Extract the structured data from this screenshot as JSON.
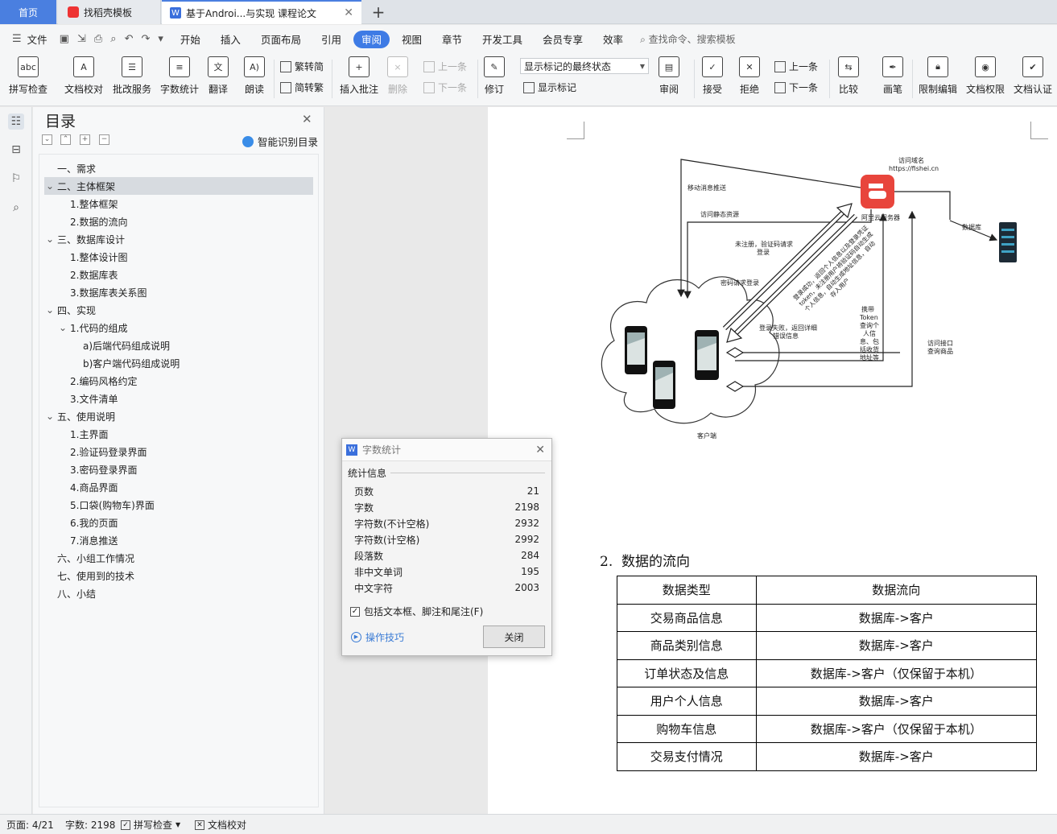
{
  "tabs": {
    "home": "首页",
    "template": "找稻壳模板",
    "document": "基于Androi...与实现 课程论文"
  },
  "menu": {
    "file": "文件",
    "items": [
      "开始",
      "插入",
      "页面布局",
      "引用",
      "审阅",
      "视图",
      "章节",
      "开发工具",
      "会员专享",
      "效率"
    ],
    "active": "审阅",
    "search_placeholder": "查找命令、搜索模板"
  },
  "ribbon": {
    "spellcheck": "拼写检查",
    "doc_proofread": "文档校对",
    "batch_service": "批改服务",
    "word_count": "字数统计",
    "translate": "翻译",
    "read_aloud": "朗读",
    "trad_to_simp": "繁转简",
    "simp_to_trad": "简转繁",
    "insert_comment": "插入批注",
    "delete": "删除",
    "prev_comment": "上一条",
    "next_comment": "下一条",
    "track_changes": "修订",
    "markup_mode": "显示标记的最终状态",
    "show_markup": "显示标记",
    "review": "审阅",
    "accept": "接受",
    "reject": "拒绝",
    "prev_change": "上一条",
    "next_change": "下一条",
    "compare": "比较",
    "pen": "画笔",
    "restrict_edit": "限制编辑",
    "doc_permission": "文档权限",
    "doc_auth": "文档认证"
  },
  "toc": {
    "title": "目录",
    "smart_label": "智能识别目录",
    "items": [
      {
        "label": "一、需求",
        "level": 0,
        "arrow": ""
      },
      {
        "label": "二、主体框架",
        "level": 0,
        "arrow": "v",
        "selected": true
      },
      {
        "label": "1.整体框架",
        "level": 1,
        "arrow": ""
      },
      {
        "label": "2.数据的流向",
        "level": 1,
        "arrow": ""
      },
      {
        "label": "三、数据库设计",
        "level": 0,
        "arrow": "v"
      },
      {
        "label": "1.整体设计图",
        "level": 1,
        "arrow": ""
      },
      {
        "label": "2.数据库表",
        "level": 1,
        "arrow": ""
      },
      {
        "label": "3.数据库表关系图",
        "level": 1,
        "arrow": ""
      },
      {
        "label": "四、实现",
        "level": 0,
        "arrow": "v"
      },
      {
        "label": "1.代码的组成",
        "level": 1,
        "arrow": "v"
      },
      {
        "label": "a)后端代码组成说明",
        "level": 2,
        "arrow": ""
      },
      {
        "label": "b)客户端代码组成说明",
        "level": 2,
        "arrow": ""
      },
      {
        "label": "2.编码风格约定",
        "level": 1,
        "arrow": ""
      },
      {
        "label": "3.文件清单",
        "level": 1,
        "arrow": ""
      },
      {
        "label": "五、使用说明",
        "level": 0,
        "arrow": "v"
      },
      {
        "label": "1.主界面",
        "level": 1,
        "arrow": ""
      },
      {
        "label": "2.验证码登录界面",
        "level": 1,
        "arrow": ""
      },
      {
        "label": "3.密码登录界面",
        "level": 1,
        "arrow": ""
      },
      {
        "label": "4.商品界面",
        "level": 1,
        "arrow": ""
      },
      {
        "label": "5.口袋(购物车)界面",
        "level": 1,
        "arrow": ""
      },
      {
        "label": "6.我的页面",
        "level": 1,
        "arrow": ""
      },
      {
        "label": "7.消息推送",
        "level": 1,
        "arrow": ""
      },
      {
        "label": "六、小组工作情况",
        "level": 0,
        "arrow": ""
      },
      {
        "label": "七、使用到的技术",
        "level": 0,
        "arrow": ""
      },
      {
        "label": "八、小结",
        "level": 0,
        "arrow": ""
      }
    ]
  },
  "diagram": {
    "domain_label": "访问域名",
    "domain_url": "https://fishei.cn",
    "server_label": "阿里云服务器",
    "database_label": "数据库",
    "client_label": "客户端",
    "push_label": "移动消息推送",
    "static_label": "访问静态资源",
    "unregistered_label_1": "未注册，验证码请求",
    "unregistered_label_2": "登录",
    "password_login_label": "密码请求登录",
    "success_lines": [
      "登录成功，返回个人信息以及登录凭证",
      "token，未注册用户将验证码自动生成",
      "个人信息，自动生成地址信息，自动",
      "存入用户"
    ],
    "fail_label_1": "登录失败，返回详细",
    "fail_label_2": "错误信息",
    "token_lines": [
      "携带",
      "Token",
      "查询个",
      "人信",
      "息、包",
      "括收货",
      "地址等"
    ],
    "api_label_1": "访问接口",
    "api_label_2": "查询商品"
  },
  "document": {
    "section_number": "2.",
    "section_title": "数据的流向",
    "table_headers": [
      "数据类型",
      "数据流向"
    ],
    "table_rows": [
      [
        "交易商品信息",
        "数据库->客户"
      ],
      [
        "商品类别信息",
        "数据库->客户"
      ],
      [
        "订单状态及信息",
        "数据库->客户（仅保留于本机）"
      ],
      [
        "用户个人信息",
        "数据库->客户"
      ],
      [
        "购物车信息",
        "数据库->客户（仅保留于本机）"
      ],
      [
        "交易支付情况",
        "数据库->客户"
      ]
    ]
  },
  "word_count_dialog": {
    "title": "字数统计",
    "group": "统计信息",
    "rows": [
      {
        "label": "页数",
        "value": "21"
      },
      {
        "label": "字数",
        "value": "2198"
      },
      {
        "label": "字符数(不计空格)",
        "value": "2932"
      },
      {
        "label": "字符数(计空格)",
        "value": "2992"
      },
      {
        "label": "段落数",
        "value": "284"
      },
      {
        "label": "非中文单词",
        "value": "195"
      },
      {
        "label": "中文字符",
        "value": "2003"
      }
    ],
    "include_checkbox": "包括文本框、脚注和尾注(F)",
    "include_checked": true,
    "tips": "操作技巧",
    "close_button": "关闭"
  },
  "status": {
    "page": "页面: 4/21",
    "words": "字数: 2198",
    "spellcheck": "拼写检查",
    "proofread": "文档校对"
  },
  "colors": {
    "accent": "#3e7be5",
    "server_red": "#e8453c",
    "link_blue": "#3a7bd5"
  }
}
